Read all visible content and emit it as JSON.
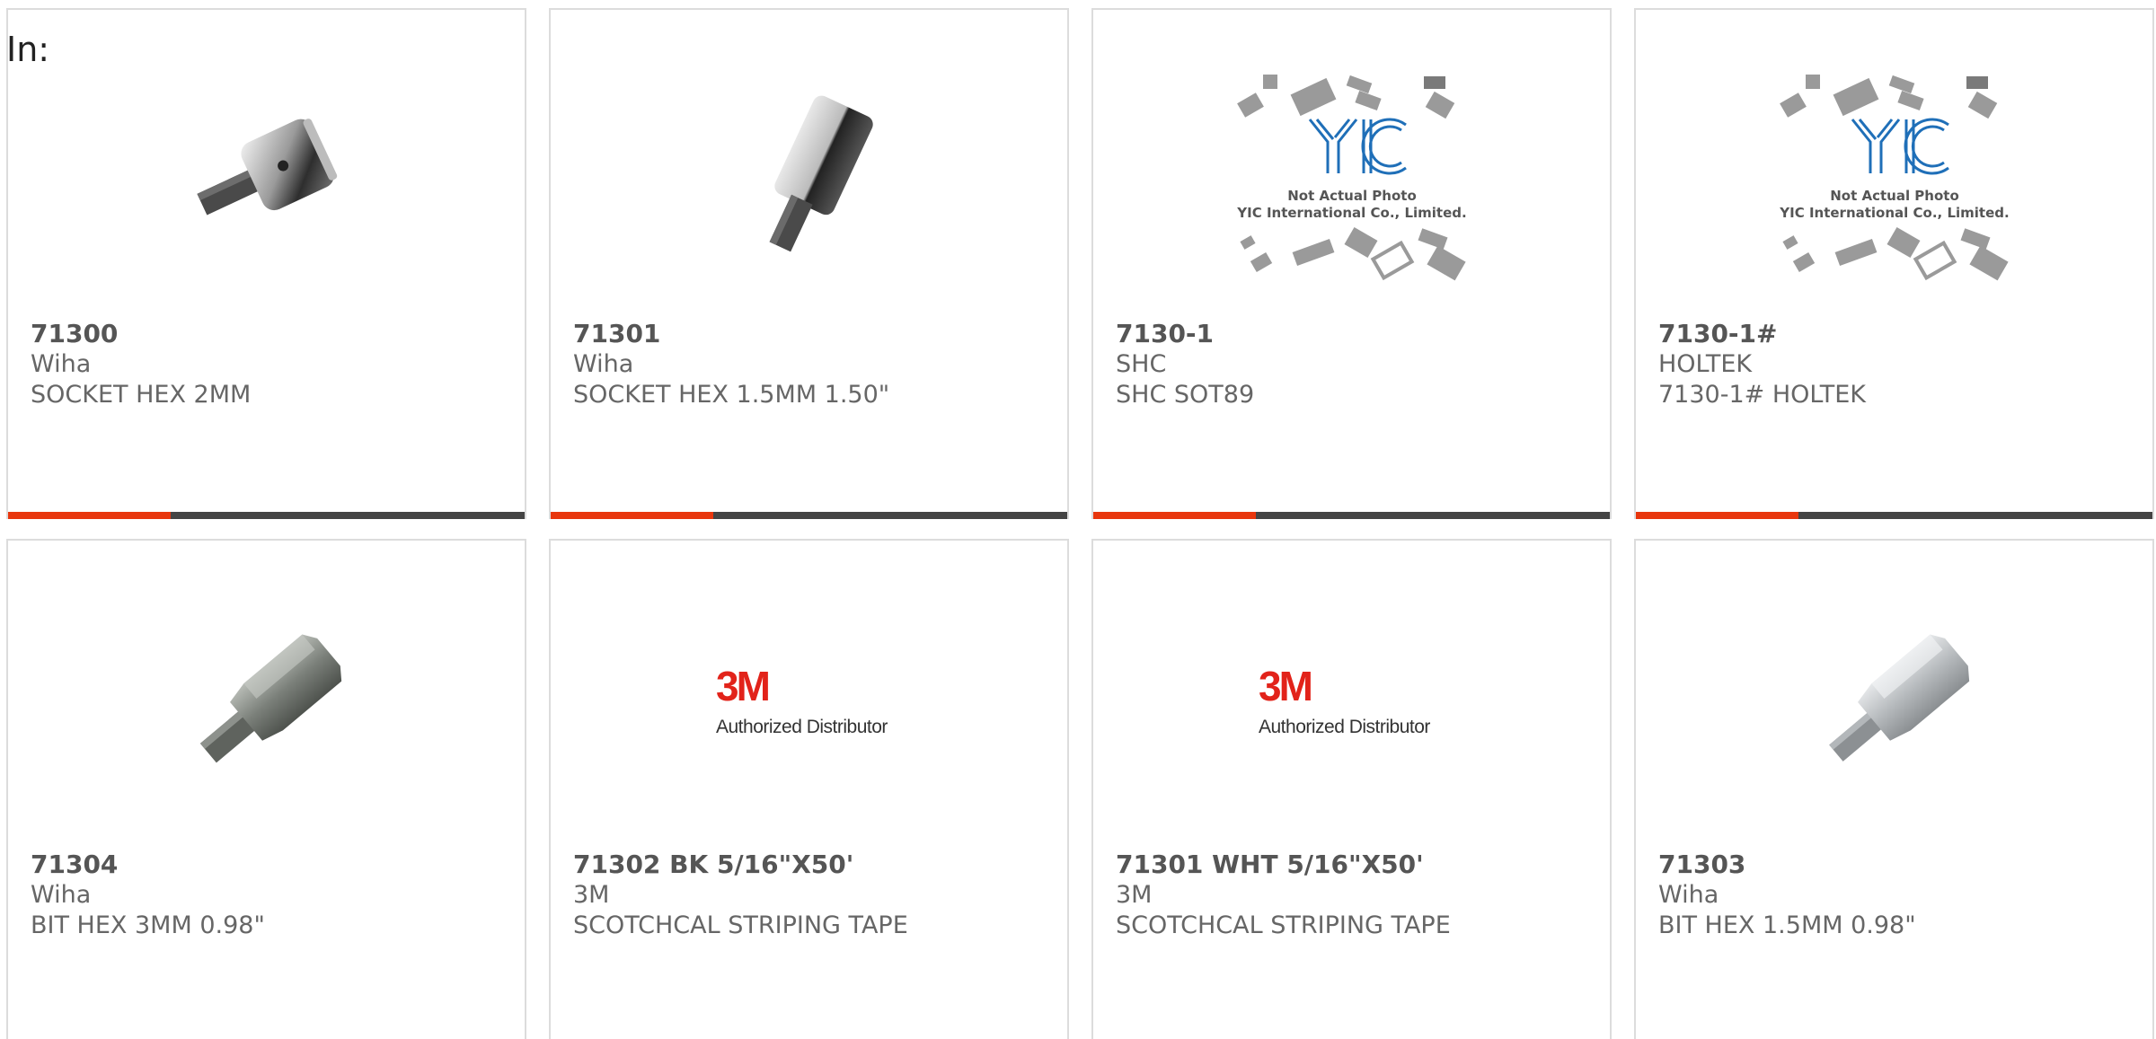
{
  "header": {
    "label": "In:"
  },
  "colors": {
    "accent": "#e8360d",
    "bar": "#444444",
    "border": "#dcdcdc",
    "text": "#666666",
    "yic_blue": "#1f6fb8",
    "brand_3m": "#e2231a"
  },
  "products": [
    {
      "part": "71300",
      "manufacturer": "Wiha",
      "description": "SOCKET HEX 2MM",
      "image": "hex-socket-icon"
    },
    {
      "part": "71301",
      "manufacturer": "Wiha",
      "description": "SOCKET HEX 1.5MM 1.50\"",
      "image": "hex-socket-long-icon"
    },
    {
      "part": "7130-1",
      "manufacturer": "SHC",
      "description": "SHC SOT89",
      "image": "yic-placeholder-icon",
      "placeholder": {
        "line1": "Not Actual Photo",
        "line2": "YIC International Co., Limited."
      }
    },
    {
      "part": "7130-1#",
      "manufacturer": "HOLTEK",
      "description": "7130-1# HOLTEK",
      "image": "yic-placeholder-icon",
      "placeholder": {
        "line1": "Not Actual Photo",
        "line2": "YIC International Co., Limited."
      }
    },
    {
      "part": "71304",
      "manufacturer": "Wiha",
      "description": "BIT HEX 3MM 0.98\"",
      "image": "hex-bit-icon"
    },
    {
      "part": "71302 BK 5/16\"X50'",
      "manufacturer": "3M",
      "description": "SCOTCHCAL STRIPING TAPE",
      "image": "3m-logo-icon",
      "logo": {
        "brand": "3M",
        "tagline": "Authorized Distributor"
      }
    },
    {
      "part": "71301 WHT 5/16\"X50'",
      "manufacturer": "3M",
      "description": "SCOTCHCAL STRIPING TAPE",
      "image": "3m-logo-icon",
      "logo": {
        "brand": "3M",
        "tagline": "Authorized Distributor"
      }
    },
    {
      "part": "71303",
      "manufacturer": "Wiha",
      "description": "BIT HEX 1.5MM 0.98\"",
      "image": "hex-bit-silver-icon"
    }
  ]
}
